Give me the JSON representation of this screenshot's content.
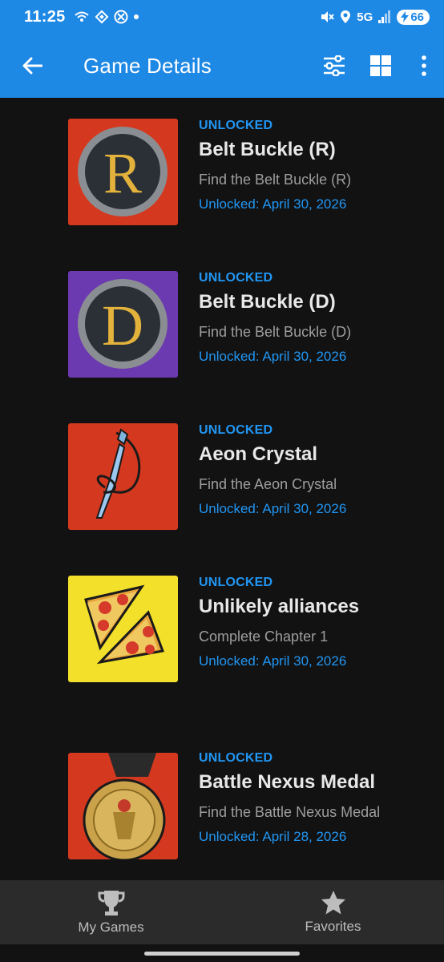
{
  "status_bar": {
    "time": "11:25",
    "network": "5G",
    "battery": "66"
  },
  "app_bar": {
    "title": "Game Details"
  },
  "achievements": [
    {
      "status": "UNLOCKED",
      "name": "Belt Buckle (R)",
      "description": "Find the Belt Buckle (R)",
      "date": "Unlocked: April 30, 2026",
      "icon": "belt-buckle-r-icon",
      "bg_color": "#d4391f"
    },
    {
      "status": "UNLOCKED",
      "name": "Belt Buckle (D)",
      "description": "Find the Belt Buckle (D)",
      "date": "Unlocked: April 30, 2026",
      "icon": "belt-buckle-d-icon",
      "bg_color": "#6c3ab0"
    },
    {
      "status": "UNLOCKED",
      "name": "Aeon Crystal",
      "description": "Find the Aeon Crystal",
      "date": "Unlocked: April 30, 2026",
      "icon": "aeon-crystal-icon",
      "bg_color": "#d4391f"
    },
    {
      "status": "UNLOCKED",
      "name": "Unlikely alliances",
      "description": "Complete Chapter 1",
      "date": "Unlocked: April 30, 2026",
      "icon": "pizza-icon",
      "bg_color": "#f2e02a"
    },
    {
      "status": "UNLOCKED",
      "name": "Battle Nexus Medal",
      "description": "Find the Battle Nexus Medal",
      "date": "Unlocked: April 28, 2026",
      "icon": "medal-icon",
      "bg_color": "#d4391f"
    }
  ],
  "bottom_nav": {
    "my_games": "My Games",
    "favorites": "Favorites"
  },
  "colors": {
    "accent": "#1e88e5",
    "status_blue": "#2196f3",
    "background": "#121212"
  }
}
